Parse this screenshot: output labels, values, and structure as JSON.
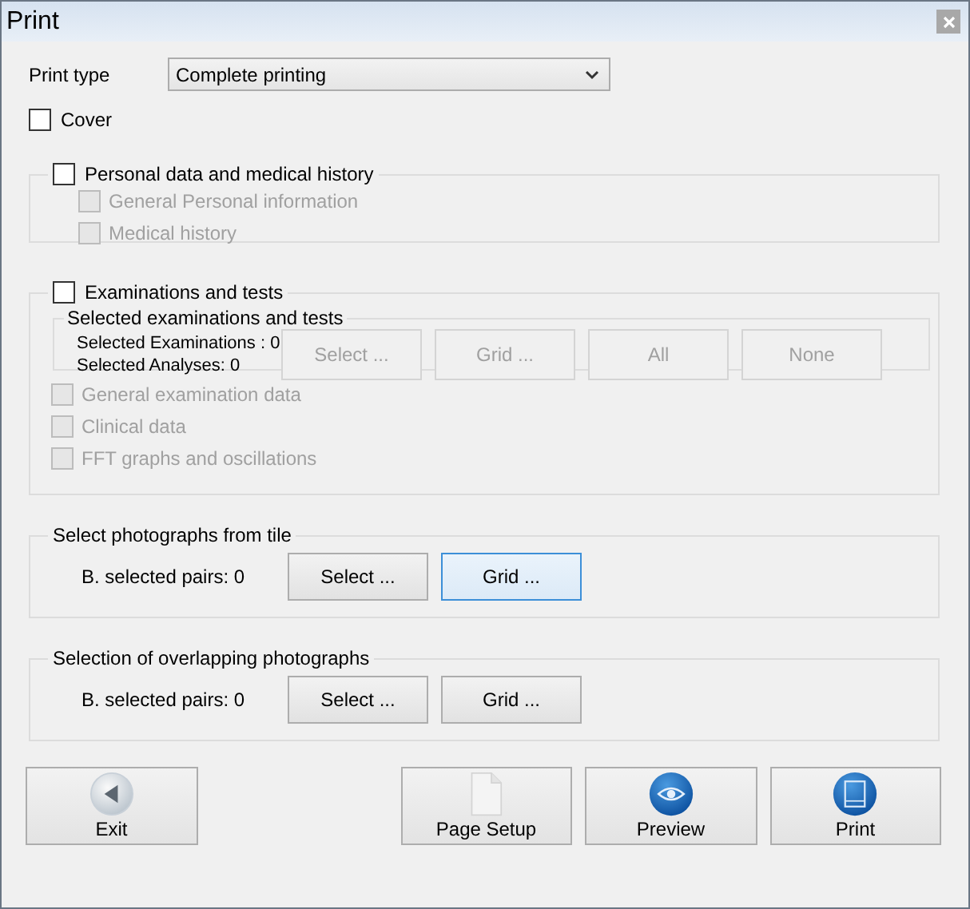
{
  "window": {
    "title": "Print"
  },
  "print_type": {
    "label": "Print type",
    "value": "Complete printing"
  },
  "cover": {
    "label": "Cover",
    "checked": false
  },
  "personal": {
    "label": "Personal data and medical history",
    "checked": false,
    "options": [
      {
        "label": "General Personal information",
        "checked": false,
        "disabled": true
      },
      {
        "label": "Medical history",
        "checked": false,
        "disabled": true
      }
    ]
  },
  "examinations": {
    "label": "Examinations and tests",
    "checked": false,
    "subgroup": {
      "title": "Selected examinations and tests",
      "counts": [
        "Selected Examinations : 0",
        "Selected Analyses: 0"
      ],
      "buttons": [
        {
          "label": "Select ...",
          "disabled": true
        },
        {
          "label": "Grid ...",
          "disabled": true
        },
        {
          "label": "All",
          "disabled": true
        },
        {
          "label": "None",
          "disabled": true
        }
      ]
    },
    "options": [
      {
        "label": "General examination data",
        "checked": false,
        "disabled": true
      },
      {
        "label": "Clinical data",
        "checked": false,
        "disabled": true
      },
      {
        "label": "FFT graphs and oscillations",
        "checked": false,
        "disabled": true
      }
    ]
  },
  "photo_groups": [
    {
      "title": "Select photographs from tile",
      "count": "B. selected pairs: 0",
      "buttons": [
        {
          "label": "Select ...",
          "focused": false
        },
        {
          "label": "Grid ...",
          "focused": true
        }
      ]
    },
    {
      "title": "Selection of overlapping photographs",
      "count": "B. selected pairs: 0",
      "buttons": [
        {
          "label": "Select ...",
          "focused": false
        },
        {
          "label": "Grid ...",
          "focused": false
        }
      ]
    }
  ],
  "actions": [
    {
      "label": "Exit",
      "kind": "exit"
    },
    {
      "label": "Page Setup",
      "kind": "page"
    },
    {
      "label": "Preview",
      "kind": "preview"
    },
    {
      "label": "Print",
      "kind": "print"
    }
  ]
}
